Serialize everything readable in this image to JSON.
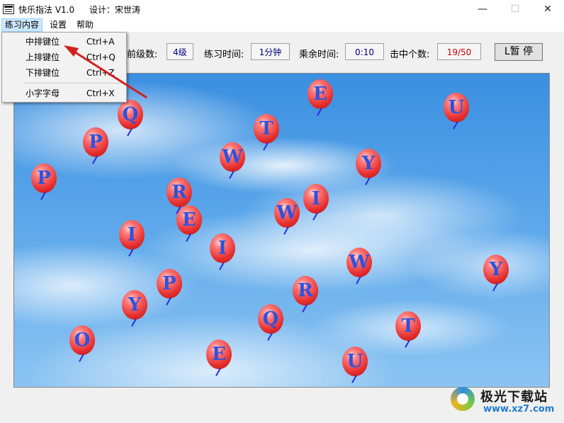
{
  "window": {
    "title": "快乐指法 V1.0",
    "designer": "设计：宋世涛",
    "minimize_glyph": "—",
    "maximize_glyph": "☐",
    "close_glyph": "✕"
  },
  "menubar": {
    "items": [
      "练习内容",
      "设置",
      "帮助"
    ]
  },
  "dropdown": {
    "items": [
      {
        "label": "中排键位",
        "shortcut": "Ctrl+A"
      },
      {
        "label": "上排键位",
        "shortcut": "Ctrl+Q"
      },
      {
        "label": "下排键位",
        "shortcut": "Ctrl+Z"
      },
      {
        "label": "小字字母",
        "shortcut": "Ctrl+X"
      }
    ]
  },
  "toolbar": {
    "level_label": "前级数:",
    "level_value": "4级",
    "practice_time_label": "练习时间:",
    "practice_time_value": "1分钟",
    "remaining_label": "乘余时间:",
    "remaining_value": "0:10",
    "hits_label": "击中个数:",
    "hits_value": "19/50",
    "pause_label": "L暂  停"
  },
  "balloons": [
    "E",
    "U",
    "Q",
    "P",
    "T",
    "W",
    "Y",
    "P",
    "R",
    "I",
    "E",
    "W",
    "I",
    "Y",
    "I",
    "W",
    "P",
    "R",
    "Y",
    "Q",
    "T",
    "O",
    "E",
    "U"
  ],
  "watermark": {
    "name": "极光下载站",
    "url": "www.xz7.com"
  },
  "colors": {
    "hits_value": "#cc0000",
    "field_value": "#000080",
    "balloon_letter": "#2a53e0",
    "arrow": "#d42020"
  }
}
